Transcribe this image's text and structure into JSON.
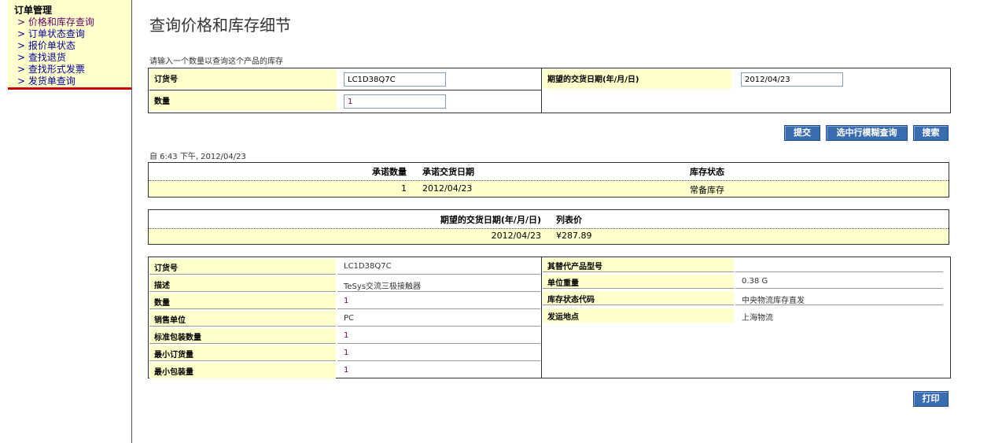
{
  "nav": {
    "title": "订单管理",
    "items": [
      {
        "label": "> 价格和库存查询"
      },
      {
        "label": "> 订单状态查询"
      },
      {
        "label": "> 报价单状态"
      },
      {
        "label": "> 查找退货"
      },
      {
        "label": "> 查找形式发票"
      },
      {
        "label": "> 发货单查询"
      }
    ]
  },
  "page": {
    "title": "查询价格和库存细节",
    "instruction": "请输入一个数量以查询这个产品的库存"
  },
  "form": {
    "order_no_label": "订货号",
    "order_no_value": "LC1D38Q7C",
    "quantity_label": "数量",
    "quantity_value": "1",
    "date_label": "期望的交货日期(年/月/日)",
    "date_value": "2012/04/23"
  },
  "buttons": {
    "submit": "提交",
    "fuzzy": "选中行模糊查询",
    "search": "搜索",
    "print": "打印"
  },
  "timestamp": "自 6:43 下午, 2012/04/23",
  "stock_table": {
    "headers": [
      "承诺数量",
      "承诺交货日期",
      "库存状态"
    ],
    "row": [
      "1",
      "2012/04/23",
      "常备库存"
    ]
  },
  "price_table": {
    "headers": [
      "期望的交货日期(年/月/日)",
      "列表价"
    ],
    "row": [
      "2012/04/23",
      "¥287.89"
    ]
  },
  "details_left": [
    {
      "label": "订货号",
      "value": "LC1D38Q7C"
    },
    {
      "label": "描述",
      "value": "TeSys交流三极接触器"
    },
    {
      "label": "数量",
      "value": "1"
    },
    {
      "label": "销售单位",
      "value": "PC"
    },
    {
      "label": "标准包装数量",
      "value": "1"
    },
    {
      "label": "最小订货量",
      "value": "1"
    },
    {
      "label": "最小包装量",
      "value": "1"
    }
  ],
  "details_right": [
    {
      "label": "其替代产品型号",
      "value": ""
    },
    {
      "label": "单位重量",
      "value": "0.38 G"
    },
    {
      "label": "库存状态代码",
      "value": "中央物流库存直发"
    },
    {
      "label": "发运地点",
      "value": "上海物流"
    }
  ]
}
